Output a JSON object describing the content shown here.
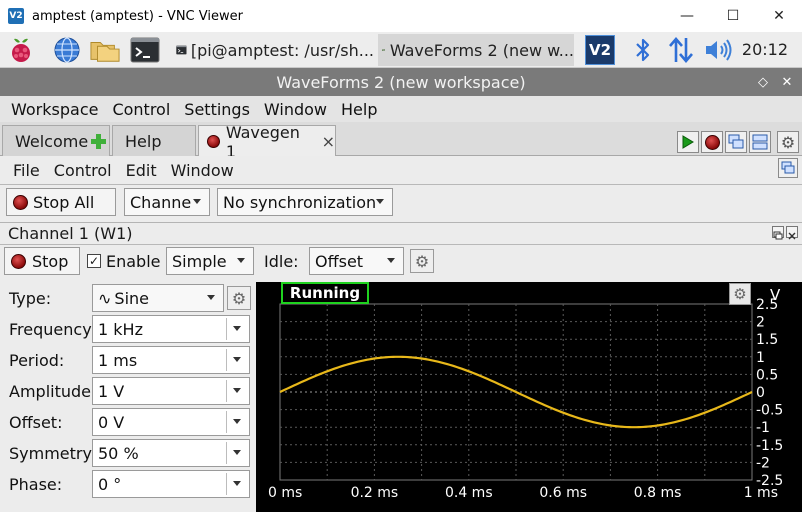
{
  "vnc_window": {
    "title": "amptest (amptest) - VNC Viewer",
    "logo_text": "V2",
    "minimize": "—",
    "maximize": "☐",
    "close": "✕"
  },
  "taskbar": {
    "tasks": [
      {
        "label": "[pi@amptest: /usr/sh..."
      },
      {
        "label": "WaveForms 2 (new w..."
      }
    ],
    "vnc_icon_text": "V2",
    "clock": "20:12"
  },
  "app": {
    "title": "WaveForms 2 (new workspace)",
    "restore": "◇",
    "close": "✕",
    "menu": [
      "Workspace",
      "Control",
      "Settings",
      "Window",
      "Help"
    ]
  },
  "tabs": [
    {
      "label": "Welcome"
    },
    {
      "label": "Help"
    },
    {
      "label": "Wavegen 1",
      "close": "×"
    }
  ],
  "wavegen": {
    "menu": [
      "File",
      "Control",
      "Edit",
      "Window"
    ],
    "stop_all_label": "Stop All",
    "channels_label": "Channels",
    "sync_value": "No synchronization",
    "channel_title": "Channel 1 (W1)",
    "stop_label": "Stop",
    "enable_label": "Enable",
    "enable_checked": "✓",
    "mode_value": "Simple",
    "idle_label": "Idle:",
    "idle_value": "Offset",
    "params": [
      {
        "label": "Type:",
        "value": "Sine",
        "icon": "∿"
      },
      {
        "label": "Frequency:",
        "value": "1 kHz"
      },
      {
        "label": "Period:",
        "value": "1 ms"
      },
      {
        "label": "Amplitude:",
        "value": "1 V"
      },
      {
        "label": "Offset:",
        "value": "0 V"
      },
      {
        "label": "Symmetry:",
        "value": "50 %"
      },
      {
        "label": "Phase:",
        "value": "0 °"
      }
    ]
  },
  "plot": {
    "status": "Running",
    "y_unit": "V",
    "y_ticks": [
      "2.5",
      "2",
      "1.5",
      "1",
      "0.5",
      "0",
      "-0.5",
      "-1",
      "-1.5",
      "-2",
      "-2.5"
    ],
    "x_ticks": [
      "0 ms",
      "0.2 ms",
      "0.4 ms",
      "0.6 ms",
      "0.8 ms",
      "1 ms"
    ],
    "signal_color": "#e8b81a",
    "grid_color": "#5a5a5a",
    "amplitude_v": 1,
    "offset_v": 0,
    "frequency_hz": 1000,
    "time_span_ms": 1,
    "y_range_v": [
      -2.5,
      2.5
    ]
  }
}
